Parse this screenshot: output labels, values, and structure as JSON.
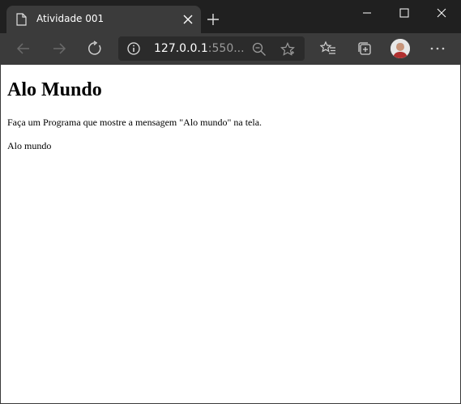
{
  "browser": {
    "tab": {
      "title": "Atividade 001"
    },
    "address_bar": {
      "host": "127.0.0.1",
      "rest": ":550..."
    },
    "colors": {
      "titlebar": "#202020",
      "toolbar": "#3b3b3b",
      "omnibox": "#2b2b2b",
      "icon": "#d0d0d0",
      "icon_disabled": "#6b6b6b"
    }
  },
  "page": {
    "heading": "Alo Mundo",
    "instruction": "Faça um Programa que mostre a mensagem \"Alo mundo\" na tela.",
    "output": "Alo mundo"
  }
}
